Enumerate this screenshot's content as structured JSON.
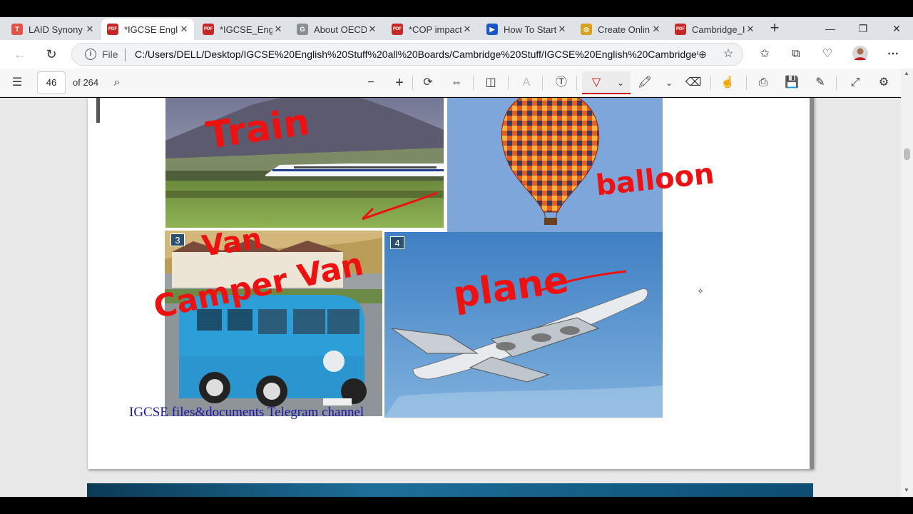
{
  "tabs": [
    {
      "title": "LAID Synony",
      "icon": "T",
      "color": "#e0534a"
    },
    {
      "title": "*IGCSE Engli",
      "icon": "PDF",
      "color": "#c62828",
      "active": true
    },
    {
      "title": "*IGCSE_Engl",
      "icon": "PDF",
      "color": "#c62828"
    },
    {
      "title": "About OECD",
      "icon": "G",
      "color": "#8a8f96"
    },
    {
      "title": "*COP impact",
      "icon": "PDF",
      "color": "#c62828"
    },
    {
      "title": "How To Start",
      "icon": "▶",
      "color": "#1a56c4"
    },
    {
      "title": "Create Onlin",
      "icon": "◎",
      "color": "#d9a21c"
    },
    {
      "title": "Cambridge_I",
      "icon": "PDF",
      "color": "#c62828"
    }
  ],
  "address": {
    "scheme_label": "File",
    "url": "C:/Users/DELL/Desktop/IGCSE%20English%20Stuff%20all%20Boards/Cambridge%20Stuff/IGCSE%20English%20Cambridge%..."
  },
  "pdf_toolbar": {
    "page_number": "46",
    "page_total": "of 264"
  },
  "page": {
    "caption": "IGCSE files&documents Telegram channel",
    "badges": [
      "3",
      "4"
    ],
    "annotations": {
      "train": "Train",
      "balloon": "balloon",
      "van": "Van",
      "camper_van": "Camper Van",
      "plane": "plane"
    }
  },
  "colors": {
    "ink": "#e11111",
    "caption": "#1a1aa6",
    "active_tool": "#c00000"
  }
}
